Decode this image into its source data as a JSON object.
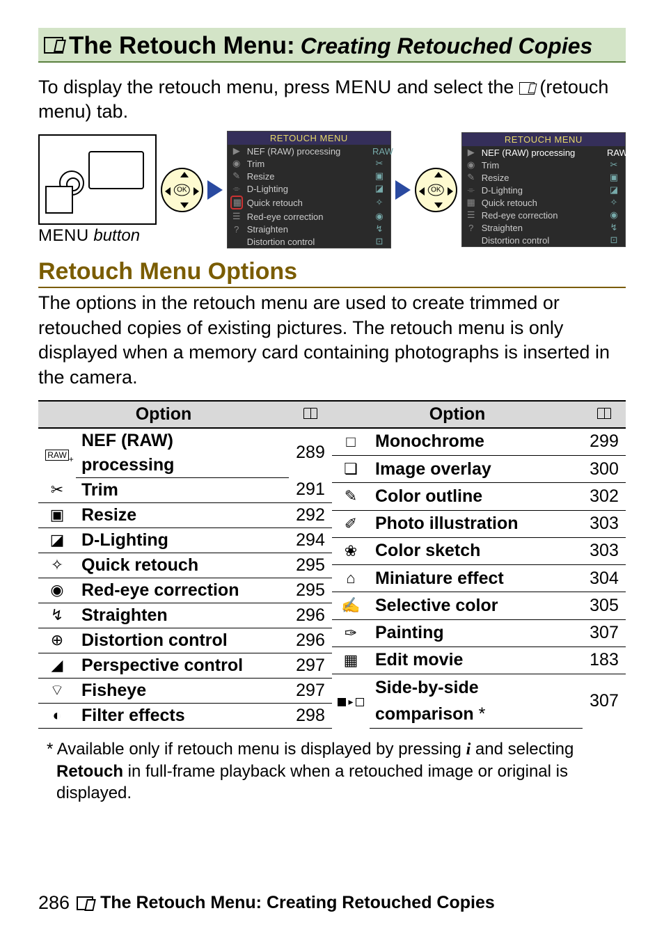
{
  "title": {
    "main": "The Retouch Menu:",
    "sub": "Creating Retouched Copies"
  },
  "intro": {
    "pre": "To display the retouch menu, press ",
    "menu_word": "MENU",
    "mid": " and select the ",
    "post": " (retouch menu) tab."
  },
  "menu_button_label": {
    "word": "MENU",
    "suffix": " button"
  },
  "screenshot": {
    "header": "RETOUCH MENU",
    "items": [
      {
        "label": "NEF (RAW) processing",
        "ric": "RAW"
      },
      {
        "label": "Trim",
        "ric": "✂"
      },
      {
        "label": "Resize",
        "ric": "▣"
      },
      {
        "label": "D-Lighting",
        "ric": "◪"
      },
      {
        "label": "Quick retouch",
        "ric": "✧"
      },
      {
        "label": "Red-eye correction",
        "ric": "◉"
      },
      {
        "label": "Straighten",
        "ric": "↯"
      },
      {
        "label": "Distortion control",
        "ric": "⊡"
      }
    ]
  },
  "section_heading": "Retouch Menu Options",
  "section_para": "The options in the retouch menu are used to create trimmed or retouched copies of existing pictures.  The retouch menu is only displayed when a memory card containing photographs is inserted in the camera.",
  "table_header": {
    "option": "Option"
  },
  "left_rows": [
    {
      "icon": "raw",
      "label_top": "NEF (RAW)",
      "label_bot": "processing",
      "page": "289",
      "twoline": true
    },
    {
      "icon": "✂",
      "label": "Trim",
      "page": "291"
    },
    {
      "icon": "▣",
      "label": "Resize",
      "page": "292"
    },
    {
      "icon": "◪",
      "label": "D-Lighting",
      "page": "294"
    },
    {
      "icon": "✧",
      "label": "Quick retouch",
      "page": "295"
    },
    {
      "icon": "◉",
      "label": "Red-eye correction",
      "page": "295"
    },
    {
      "icon": "↯",
      "label": "Straighten",
      "page": "296"
    },
    {
      "icon": "⊕",
      "label": "Distortion control",
      "page": "296"
    },
    {
      "icon": "◢",
      "label": "Perspective control",
      "page": "297"
    },
    {
      "icon": "⌔",
      "label": "Fisheye",
      "page": "297"
    },
    {
      "icon": "◐",
      "label": "Filter effects",
      "page": "298"
    }
  ],
  "right_rows": [
    {
      "icon": "□",
      "label": "Monochrome",
      "page": "299"
    },
    {
      "icon": "❏",
      "label": "Image overlay",
      "page": "300"
    },
    {
      "icon": "✎",
      "label": "Color outline",
      "page": "302"
    },
    {
      "icon": "✐",
      "label": "Photo illustration",
      "page": "303"
    },
    {
      "icon": "❀",
      "label": "Color sketch",
      "page": "303"
    },
    {
      "icon": "⌂",
      "label": "Miniature effect",
      "page": "304"
    },
    {
      "icon": "✍",
      "label": "Selective color",
      "page": "305"
    },
    {
      "icon": "✑",
      "label": "Painting",
      "page": "307"
    },
    {
      "icon": "▦",
      "label": "Edit movie",
      "page": "183"
    },
    {
      "icon": "combo",
      "label_top": "Side-by-side",
      "label_bot": "comparison",
      "page": "307",
      "twoline": true,
      "star": true
    }
  ],
  "footnote": {
    "star": "*",
    "pre": " Available only if retouch menu is displayed by pressing ",
    "glyph": "i",
    "mid": " and selecting ",
    "bold": "Retouch",
    "post": " in full-frame playback when a retouched image or original is displayed."
  },
  "footer": {
    "page": "286",
    "text": "The Retouch Menu: Creating Retouched Copies"
  }
}
